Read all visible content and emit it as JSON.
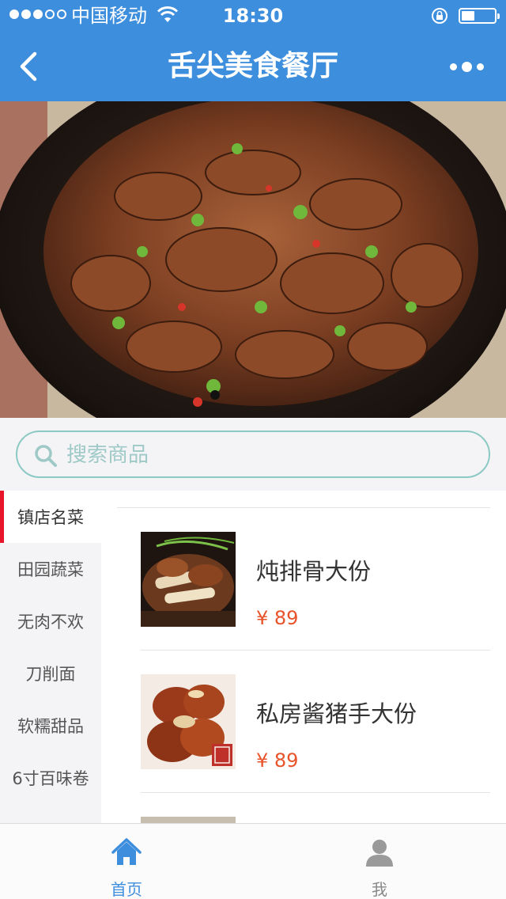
{
  "status_bar": {
    "carrier": "中国移动",
    "time": "18:30"
  },
  "nav": {
    "title": "舌尖美食餐厅"
  },
  "search": {
    "placeholder": "搜索商品"
  },
  "categories": [
    {
      "label": "镇店名菜",
      "active": true
    },
    {
      "label": "田园蔬菜",
      "active": false
    },
    {
      "label": "无肉不欢",
      "active": false
    },
    {
      "label": "刀削面",
      "active": false
    },
    {
      "label": "软糯甜品",
      "active": false
    },
    {
      "label": "6寸百味卷",
      "active": false
    }
  ],
  "products": [
    {
      "name": "炖排骨大份",
      "price": "¥ 89"
    },
    {
      "name": "私房酱猪手大份",
      "price": "¥ 89"
    }
  ],
  "tabbar": {
    "home_label": "首页",
    "me_label": "我"
  },
  "colors": {
    "brand": "#3e8ede",
    "price": "#e8532a",
    "active_marker": "#e8152a"
  },
  "icons": {
    "back": "chevron-left-icon",
    "more": "more-dots-icon",
    "search": "search-icon",
    "home": "home-icon",
    "me": "user-icon"
  }
}
